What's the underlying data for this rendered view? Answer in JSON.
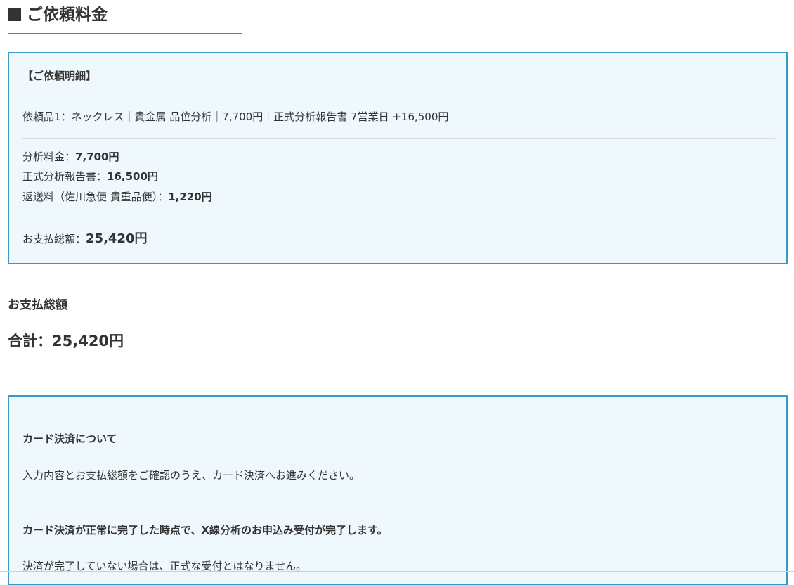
{
  "section": {
    "title": "ご依頼料金"
  },
  "details": {
    "heading": "【ご依頼明細】",
    "item_line": "依頼品1：ネックレス｜貴金属 品位分析｜7,700円｜正式分析報告書 7営業日 +16,500円",
    "analysis_fee_label": "分析料金：",
    "analysis_fee_value": "7,700円",
    "report_fee_label": "正式分析報告書：",
    "report_fee_value": "16,500円",
    "shipping_label": "返送料（佐川急便 貴重品便）：",
    "shipping_value": "1,220円",
    "total_label": "お支払総額：",
    "total_value": "25,420円"
  },
  "summary": {
    "label": "お支払総額",
    "total_label": "合計：",
    "total_value": "25,420円"
  },
  "card_notice": {
    "heading": "カード決済について",
    "line1": "入力内容とお支払総額をご確認のうえ、カード決済へお進みください。",
    "line2": "カード決済が正常に完了した時点で、X線分析のお申込み受付が完了します。",
    "line3": "決済が完了していない場合は、正式な受付とはなりません。"
  },
  "colors": {
    "accent": "#3a97c9",
    "box_bg": "#eef8fd",
    "text": "#333333"
  }
}
